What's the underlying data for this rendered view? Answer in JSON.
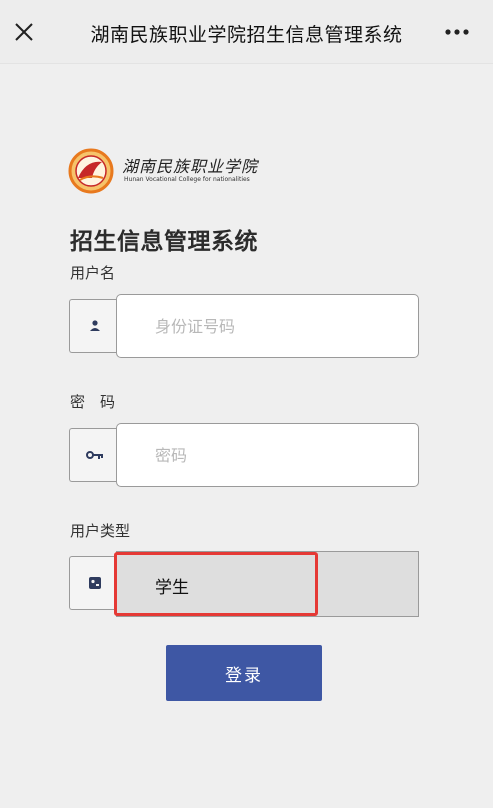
{
  "topbar": {
    "title": "湖南民族职业学院招生信息管理系统",
    "close_icon": "close-icon",
    "more_icon": "more-dots-icon"
  },
  "logo": {
    "name_cn": "湖南民族职业学院",
    "name_en": "Hunan Vocational College for nationalities"
  },
  "form": {
    "title": "招生信息管理系统",
    "username": {
      "label": "用户名",
      "placeholder": "身份证号码",
      "value": "",
      "icon": "user-icon"
    },
    "password": {
      "label": "密　码",
      "placeholder": "密码",
      "value": "",
      "icon": "key-icon"
    },
    "user_type": {
      "label": "用户类型",
      "selected": "学生",
      "icon": "id-card-icon"
    },
    "login_label": "登录"
  },
  "colors": {
    "primary": "#3e57a4",
    "highlight": "#e53935",
    "logo_orange": "#e8791e",
    "logo_red": "#c62828"
  }
}
